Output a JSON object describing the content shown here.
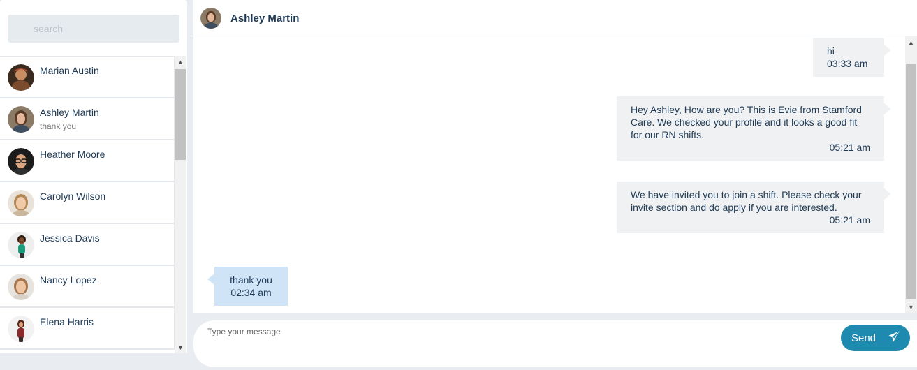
{
  "search": {
    "placeholder": "search"
  },
  "contacts": [
    {
      "name": "Marian Austin",
      "preview": ""
    },
    {
      "name": "Ashley Martin",
      "preview": "thank you"
    },
    {
      "name": "Heather Moore",
      "preview": ""
    },
    {
      "name": "Carolyn Wilson",
      "preview": ""
    },
    {
      "name": "Jessica Davis",
      "preview": ""
    },
    {
      "name": "Nancy Lopez",
      "preview": ""
    },
    {
      "name": "Elena Harris",
      "preview": ""
    }
  ],
  "chat": {
    "title": "Ashley Martin",
    "messages": [
      {
        "direction": "out",
        "text": "hi",
        "time": "03:33 am"
      },
      {
        "direction": "out",
        "text": "Hey Ashley, How are you? This is Evie from Stamford Care. We checked your profile and it looks a good fit for our RN shifts.",
        "time": "05:21 am"
      },
      {
        "direction": "out",
        "text": "We have invited you to join a shift. Please check your invite section and do apply if you are interested.",
        "time": "05:21 am"
      },
      {
        "direction": "in",
        "text": "thank you",
        "time": "02:34 am"
      }
    ]
  },
  "composer": {
    "placeholder": "Type your message",
    "send_label": "Send"
  },
  "colors": {
    "accent": "#1f8ab0",
    "incoming_bubble": "#cfe5f7",
    "outgoing_bubble": "#f0f1f2",
    "text": "#1e3a56"
  }
}
